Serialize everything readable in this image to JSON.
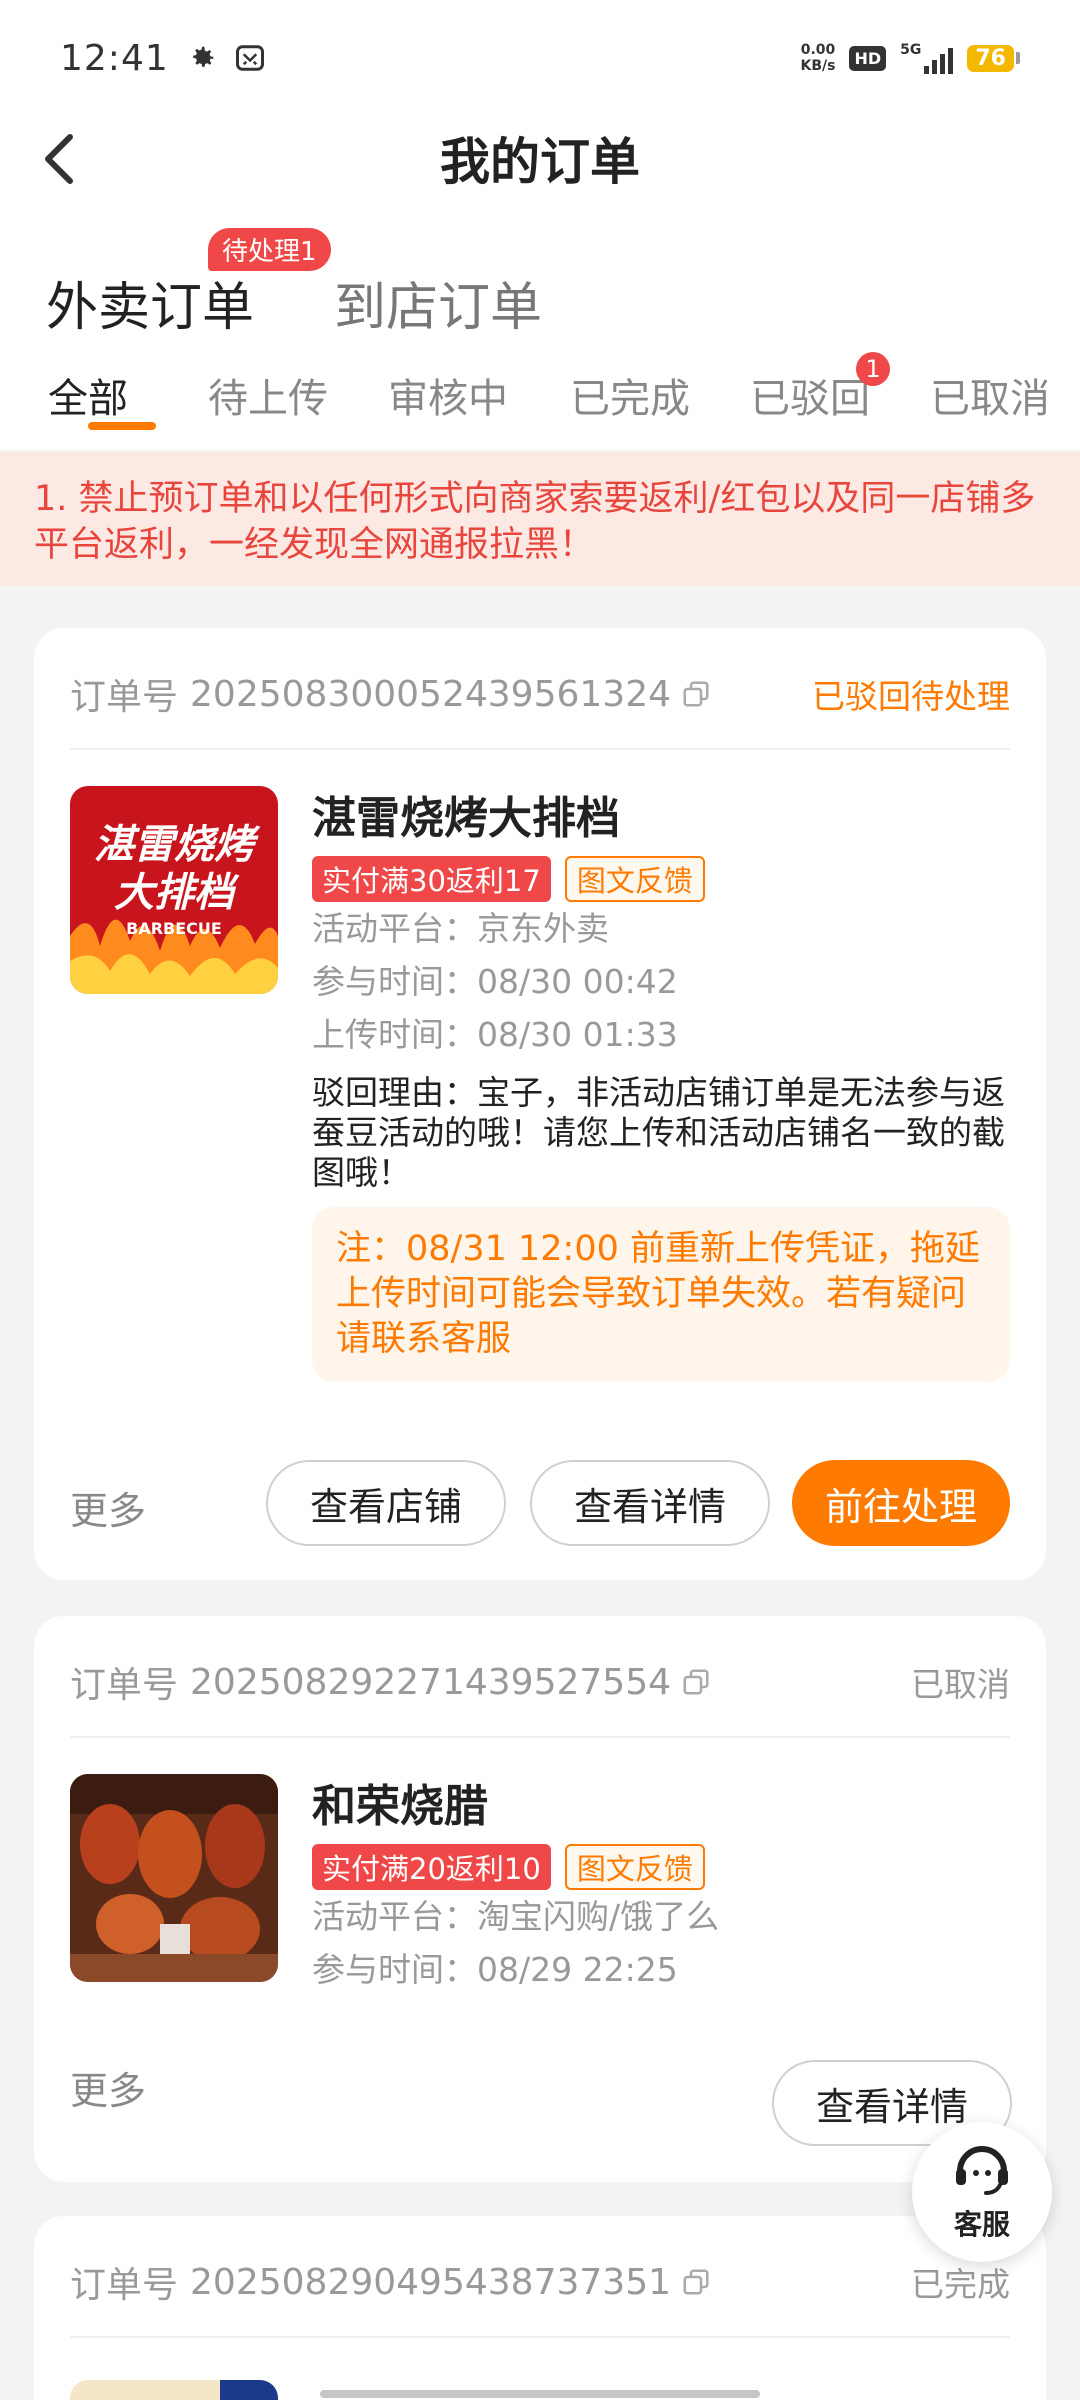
{
  "status_bar": {
    "time": "12:41",
    "net_speed_value": "0.00",
    "net_speed_unit": "KB/s",
    "hd_label": "HD",
    "network": "5G",
    "battery": "76"
  },
  "header": {
    "title": "我的订单"
  },
  "main_tabs": [
    {
      "label": "外卖订单",
      "active": true
    },
    {
      "label": "到店订单",
      "active": false
    }
  ],
  "pending_badge": "待处理1",
  "sub_tabs": [
    {
      "label": "全部",
      "active": true
    },
    {
      "label": "待上传"
    },
    {
      "label": "审核中"
    },
    {
      "label": "已完成"
    },
    {
      "label": "已驳回",
      "badge": "1"
    },
    {
      "label": "已取消"
    }
  ],
  "notice": "1. 禁止预订单和以任何形式向商家索要返利/红包以及同一店铺多平台返利，一经发现全网通报拉黑！",
  "orders": [
    {
      "order_label": "订单号",
      "order_no": "2025083000524395613 24",
      "order_no_clean": "20250830005243956132 4",
      "status": "已驳回待处理",
      "shop": "湛雷烧烤大排档",
      "logo_line1": "湛雷烧烤",
      "logo_line2": "大排档",
      "logo_sub": "BARBECUE",
      "tag_reward": "实付满30返利17",
      "tag_feedback": "图文反馈",
      "platform_label": "活动平台：",
      "platform": "京东外卖",
      "join_label": "参与时间：",
      "join_time": "08/30 00:42",
      "upload_label": "上传时间：",
      "upload_time": "08/30 01:33",
      "reason": "驳回理由：宝子，非活动店铺订单是无法参与返蚕豆活动的哦！请您上传和活动店铺名一致的截图哦！",
      "warning": "注：08/31 12:00 前重新上传凭证，拖延上传时间可能会导致订单失效。若有疑问请联系客服",
      "more": "更多",
      "btn_store": "查看店铺",
      "btn_detail": "查看详情",
      "btn_process": "前往处理"
    },
    {
      "order_label": "订单号",
      "order_no": "2025082922714395275 54",
      "status": "已取消",
      "shop": "和荣烧腊",
      "tag_reward": "实付满20返利10",
      "tag_feedback": "图文反馈",
      "platform_label": "活动平台：",
      "platform": "淘宝闪购/饿了么",
      "join_label": "参与时间：",
      "join_time": "08/29 22:25",
      "more": "更多",
      "btn_detail": "查看详情"
    },
    {
      "order_label": "订单号",
      "order_no": "2025082904954387373 51",
      "status": "已完成"
    }
  ],
  "float_service": "客服",
  "colors": {
    "accent": "#ff7a00",
    "badge_red": "#f04848",
    "notice_bg": "#fde9e4"
  }
}
